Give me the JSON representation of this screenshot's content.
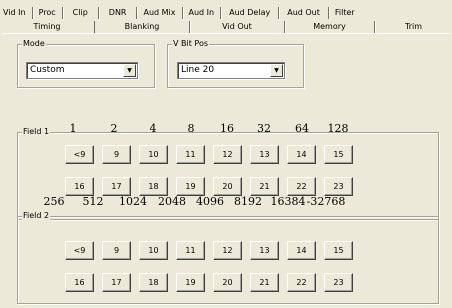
{
  "tabs_row1": [
    "Vid In",
    "Proc",
    "Clip",
    "DNR",
    "Aud Mix",
    "Aud In",
    "Aud Delay",
    "Aud Out",
    "Filter"
  ],
  "tabs_row2": [
    "Timing",
    "Blanking",
    "Vid Out",
    "Memory",
    "Trim"
  ],
  "selected_tab": "Blanking",
  "mode": {
    "label": "Mode",
    "value": "Custom"
  },
  "vbitpos": {
    "label": "V Bit Pos",
    "value": "Line 20"
  },
  "field1": {
    "label": "Field 1",
    "top_weights": [
      "1",
      "2",
      "4",
      "8",
      "16",
      "32",
      "64",
      "128"
    ],
    "row1": [
      "<9",
      "9",
      "10",
      "11",
      "12",
      "13",
      "14",
      "15"
    ],
    "row2": [
      "16",
      "17",
      "18",
      "19",
      "20",
      "21",
      "22",
      "23"
    ],
    "bottom_weights": [
      "256",
      "512",
      "1024",
      "2048",
      "4096",
      "8192",
      "16384",
      "-32768"
    ]
  },
  "field2": {
    "label": "Field 2",
    "row1": [
      "<9",
      "9",
      "10",
      "11",
      "12",
      "13",
      "14",
      "15"
    ],
    "row2": [
      "16",
      "17",
      "18",
      "19",
      "20",
      "21",
      "22",
      "23"
    ]
  }
}
